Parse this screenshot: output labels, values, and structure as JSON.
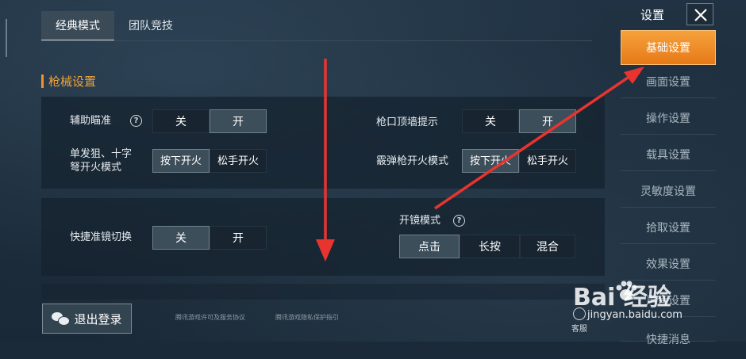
{
  "top_tabs": [
    {
      "label": "经典模式",
      "active": true
    },
    {
      "label": "团队竞技",
      "active": false
    }
  ],
  "section": {
    "title": "枪械设置"
  },
  "settings": {
    "aim_assist": {
      "label": "辅助瞄准",
      "off": "关",
      "on": "开",
      "selected": "开"
    },
    "muzzle_hint": {
      "label": "枪口顶墙提示",
      "off": "关",
      "on": "开",
      "selected": "开"
    },
    "single_fire": {
      "label_line1": "单发狙、十字",
      "label_line2": "弩开火模式",
      "press": "按下开火",
      "release": "松手开火",
      "selected": "按下开火"
    },
    "shotgun_fire": {
      "label": "霰弹枪开火模式",
      "press": "按下开火",
      "release": "松手开火",
      "selected": "按下开火"
    },
    "quick_scope": {
      "label": "快捷准镜切换",
      "off": "关",
      "on": "开",
      "selected": "关"
    },
    "scope_mode": {
      "label": "开镜模式",
      "options": [
        "点击",
        "长按",
        "混合"
      ],
      "selected": "点击"
    }
  },
  "bottom": {
    "logout_label": "退出登录",
    "link_terms": "腾讯游戏许可及服务协议",
    "link_privacy": "腾讯游戏隐私保护指引",
    "service_label": "客服"
  },
  "sidebar": {
    "title": "设置",
    "items": [
      {
        "label": "基础设置",
        "active": true
      },
      {
        "label": "画面设置",
        "active": false
      },
      {
        "label": "操作设置",
        "active": false
      },
      {
        "label": "载具设置",
        "active": false
      },
      {
        "label": "灵敏度设置",
        "active": false
      },
      {
        "label": "拾取设置",
        "active": false
      },
      {
        "label": "效果设置",
        "active": false
      },
      {
        "label": "声音设置",
        "active": false
      },
      {
        "label": "快捷消息",
        "active": false
      }
    ]
  },
  "watermark": {
    "brand": "Bai  经验",
    "url": "jingyan.baidu.com"
  },
  "colors": {
    "accent": "#f0932b",
    "annotation": "#e8342f"
  }
}
